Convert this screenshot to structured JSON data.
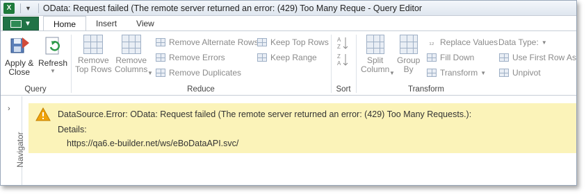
{
  "window": {
    "app_icon": "excel-icon",
    "title": "OData: Request failed (The remote server returned an error: (429) Too Many Reque - Query Editor"
  },
  "tabs": {
    "file_label": "",
    "items": [
      {
        "label": "Home",
        "active": true
      },
      {
        "label": "Insert",
        "active": false
      },
      {
        "label": "View",
        "active": false
      }
    ]
  },
  "ribbon": {
    "query": {
      "group_label": "Query",
      "apply_close_label_1": "Apply &",
      "apply_close_label_2": "Close",
      "refresh_label": "Refresh"
    },
    "reduce": {
      "group_label": "Reduce",
      "remove_top_rows_1": "Remove",
      "remove_top_rows_2": "Top Rows",
      "remove_columns_1": "Remove",
      "remove_columns_2": "Columns",
      "remove_alternate_rows": "Remove Alternate Rows",
      "remove_errors": "Remove Errors",
      "remove_duplicates": "Remove Duplicates",
      "keep_top_rows": "Keep Top Rows",
      "keep_range": "Keep Range"
    },
    "sort": {
      "group_label": "Sort"
    },
    "transform": {
      "group_label": "Transform",
      "split_column_1": "Split",
      "split_column_2": "Column",
      "group_by_1": "Group",
      "group_by_2": "By",
      "replace_values": "Replace Values",
      "fill_down": "Fill Down",
      "transform": "Transform",
      "data_type": "Data Type:",
      "use_first_row": "Use First Row As",
      "unpivot": "Unpivot"
    }
  },
  "navigator": {
    "label": "Navigator"
  },
  "error": {
    "message": "DataSource.Error: OData: Request failed (The remote server returned an error: (429) Too Many Requests.):",
    "details_label": "Details:",
    "url": "https://qa6.e-builder.net/ws/eBoDataAPI.svc/"
  },
  "colors": {
    "error_background": "#fbf3b9",
    "file_tab": "#217346",
    "disabled_text": "#8a8a8a"
  }
}
